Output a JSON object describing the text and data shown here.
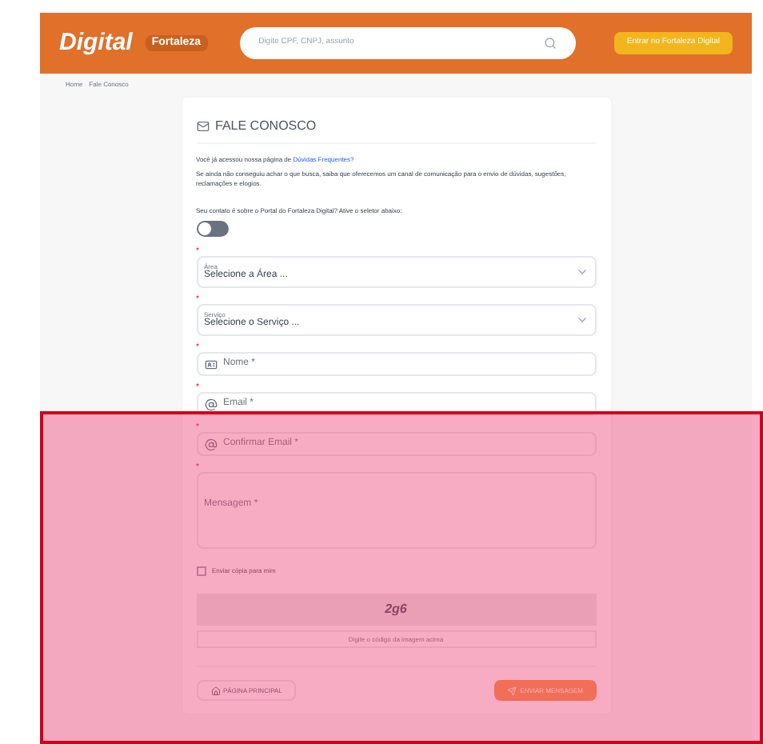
{
  "header": {
    "logo": "Digital",
    "city_logo": "Fortaleza",
    "search": {
      "placeholder": "Digite CPF, CNPJ, assunto"
    },
    "login_button": "Entrar no Fortaleza Digital"
  },
  "breadcrumb": [
    "Home",
    "Fale Conosco"
  ],
  "card": {
    "title": "FALE CONOSCO",
    "faq_text": "Você já acessou nossa página de",
    "faq_link": "Dúvidas Frequentes?",
    "intro": "Se ainda não conseguiu achar o que busca, saiba que oferecemos um canal de comunicação para o envio de dúvidas, sugestões, reclamações e elogios.",
    "toggle_label": "Seu contato é sobre o Portal do Fortaleza Digital? Ative o seletor abaixo:",
    "toggle": {
      "on": false
    },
    "fields": [
      {
        "kind": "select",
        "marker": "*",
        "label": "Área",
        "value": "Selecione a Área ..."
      },
      {
        "kind": "select",
        "marker": "*",
        "label": "Serviço",
        "value": "Selecione o Serviço ..."
      },
      {
        "kind": "name",
        "marker": "*",
        "placeholder": "Nome *"
      },
      {
        "kind": "email",
        "marker": "*",
        "placeholder": "Email *"
      },
      {
        "kind": "email",
        "marker": "*",
        "placeholder": "Confirmar Email *"
      },
      {
        "kind": "textarea",
        "marker": "*",
        "placeholder": "Mensagem *"
      }
    ],
    "copy_checkbox": {
      "label": "Enviar cópia para mim",
      "checked": false
    },
    "captcha": {
      "code": "2g6",
      "placeholder": "Digite o código da imagem acima"
    },
    "buttons": [
      {
        "kind": "secondary",
        "label": "PÁGINA PRINCIPAL"
      },
      {
        "kind": "primary",
        "label": "ENVIAR MENSAGEM"
      }
    ]
  }
}
